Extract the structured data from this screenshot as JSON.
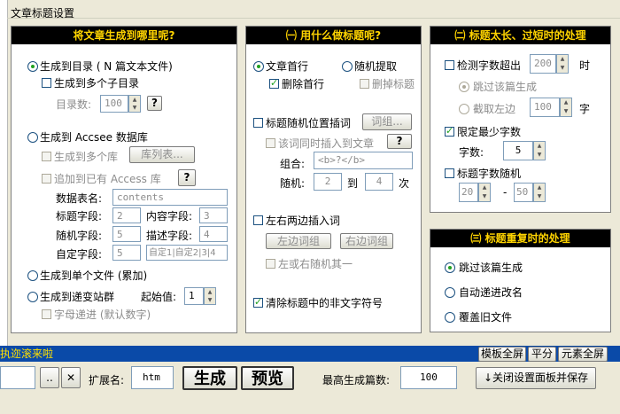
{
  "window": {
    "group_title": "文章标题设置"
  },
  "panel1": {
    "header": "将文章生成到哪里呢?",
    "opt_dir": "生成到目录 ( N 篇文本文件)",
    "opt_multi_subdir": "生成到多个子目录",
    "dir_count_label": "目录数:",
    "dir_count_value": "100",
    "help_label": "?",
    "opt_accsee": "生成到 Accsee 数据库",
    "opt_multi_db": "生成到多个库",
    "db_list_btn": "库列表...",
    "opt_append_access": "追加到已有 Access 库",
    "table_name_label": "数据表名:",
    "table_name_value": "contents",
    "title_field_label": "标题字段:",
    "title_field_value": "2",
    "content_field_label": "内容字段:",
    "content_field_value": "3",
    "random_field_label": "随机字段:",
    "random_field_value": "5",
    "desc_field_label": "描述字段:",
    "desc_field_value": "4",
    "custom_field_label": "自定字段:",
    "custom_field_value": "5",
    "custom_field_list": "自定1|自定2|3|4",
    "opt_single_file": "生成到单个文件 (累加)",
    "opt_recursive": "生成到递变站群",
    "start_value_label": "起始值:",
    "start_value": "1",
    "opt_letter_recursive": "字母递进 (默认数字)"
  },
  "panel2": {
    "header": "㈠ 用什么做标题呢?",
    "opt_first_line": "文章首行",
    "opt_random_pick": "随机提取",
    "opt_delete_first": "删除首行",
    "opt_delete_title": "删掉标题",
    "opt_random_insert": "标题随机位置插词",
    "word_group_btn": "词组...",
    "opt_insert_article": "该词同时插入到文章",
    "help_label": "?",
    "combo_label": "组合:",
    "combo_value": "<b>?</b>",
    "random_label": "随机:",
    "random_from": "2",
    "random_to_label": "到",
    "random_to": "4",
    "random_unit": "次",
    "opt_both_sides": "左右两边插入词",
    "left_words_btn": "左边词组",
    "right_words_btn": "右边词组",
    "opt_either_side": "左或右随机其一",
    "opt_clean_symbols": "清除标题中的非文字符号"
  },
  "panel3": {
    "header": "㈡ 标题太长、过短时的处理",
    "opt_detect_over": "检测字数超出",
    "detect_value": "200",
    "detect_unit": "时",
    "opt_skip": "跳过该篇生成",
    "opt_truncate": "截取左边",
    "truncate_value": "100",
    "truncate_unit": "字",
    "opt_min_words": "限定最少字数",
    "min_words_label": "字数:",
    "min_words_value": "5",
    "opt_random_len": "标题字数随机",
    "random_len_from": "20",
    "random_len_dash": "-",
    "random_len_to": "50"
  },
  "panel4": {
    "header": "㈢ 标题重复时的处理",
    "opt_skip": "跳过该篇生成",
    "opt_auto_rename": "自动递进改名",
    "opt_overwrite": "覆盖旧文件"
  },
  "statusbar": {
    "text": "执迩滚来啦"
  },
  "right_buttons": {
    "template_full": "模板全屏",
    "split": "平分",
    "element_full": "元素全屏"
  },
  "bottom": {
    "dots_btn": "..",
    "clear_btn": "✕",
    "ext_label": "扩展名:",
    "ext_value": "htm",
    "generate_btn": "生成",
    "preview_btn": "预览",
    "max_label": "最高生成篇数:",
    "max_value": "100",
    "close_save_btn": "↓关闭设置面板并保存"
  }
}
